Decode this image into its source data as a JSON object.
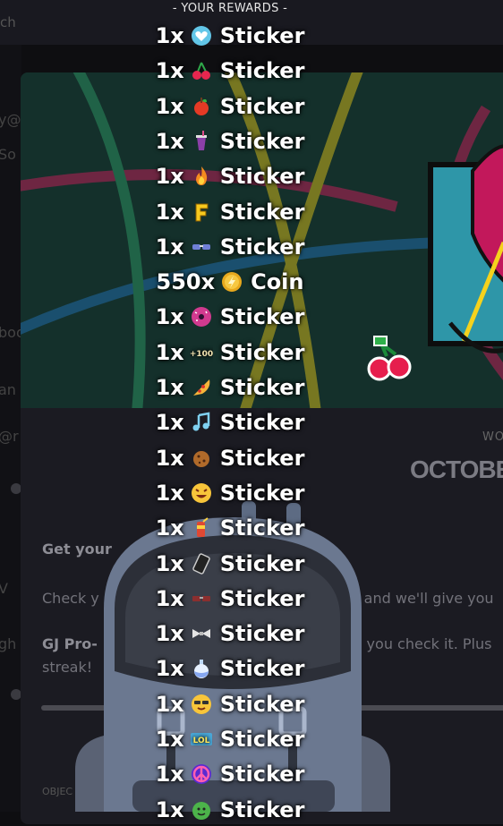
{
  "background": {
    "search_fragment": "ch",
    "sidebar_fragments": [
      "y@",
      "So",
      "boo",
      "an",
      "@r",
      "V",
      "gh"
    ],
    "date_small": "WO",
    "date_big": "OCTOBER",
    "quest_title": "Get your",
    "quest_desc_left": "Check y",
    "quest_desc_right": "r and we'll give you",
    "quest_line2_left": "GJ Pro-",
    "quest_line2_right": "y you check it. Plus",
    "quest_line3": "streak!",
    "objective_label": "OBJEC"
  },
  "rewards": {
    "header": "- YOUR REWARDS -",
    "items": [
      {
        "qty": "1x",
        "name": "Sticker",
        "icon": "heart-hands-sticker-icon"
      },
      {
        "qty": "1x",
        "name": "Sticker",
        "icon": "cherries-sticker-icon"
      },
      {
        "qty": "1x",
        "name": "Sticker",
        "icon": "apple-sticker-icon"
      },
      {
        "qty": "1x",
        "name": "Sticker",
        "icon": "soda-cup-sticker-icon"
      },
      {
        "qty": "1x",
        "name": "Sticker",
        "icon": "fire-sticker-icon"
      },
      {
        "qty": "1x",
        "name": "Sticker",
        "icon": "letter-f-sticker-icon"
      },
      {
        "qty": "1x",
        "name": "Sticker",
        "icon": "sunglasses-sticker-icon"
      },
      {
        "qty": "550x",
        "name": "Coin",
        "icon": "coin-icon"
      },
      {
        "qty": "1x",
        "name": "Sticker",
        "icon": "donut-sticker-icon"
      },
      {
        "qty": "1x",
        "name": "Sticker",
        "icon": "plus-100-sticker-icon"
      },
      {
        "qty": "1x",
        "name": "Sticker",
        "icon": "pizza-sticker-icon"
      },
      {
        "qty": "1x",
        "name": "Sticker",
        "icon": "music-note-sticker-icon"
      },
      {
        "qty": "1x",
        "name": "Sticker",
        "icon": "cookie-sticker-icon"
      },
      {
        "qty": "1x",
        "name": "Sticker",
        "icon": "laughing-face-sticker-icon"
      },
      {
        "qty": "1x",
        "name": "Sticker",
        "icon": "drink-can-sticker-icon"
      },
      {
        "qty": "1x",
        "name": "Sticker",
        "icon": "phone-sticker-icon"
      },
      {
        "qty": "1x",
        "name": "Sticker",
        "icon": "shades-sticker-icon"
      },
      {
        "qty": "1x",
        "name": "Sticker",
        "icon": "bow-tie-sticker-icon"
      },
      {
        "qty": "1x",
        "name": "Sticker",
        "icon": "potion-sticker-icon"
      },
      {
        "qty": "1x",
        "name": "Sticker",
        "icon": "cool-face-sticker-icon"
      },
      {
        "qty": "1x",
        "name": "Sticker",
        "icon": "lol-sticker-icon"
      },
      {
        "qty": "1x",
        "name": "Sticker",
        "icon": "peace-sign-sticker-icon"
      },
      {
        "qty": "1x",
        "name": "Sticker",
        "icon": "green-face-sticker-icon"
      }
    ]
  },
  "colors": {
    "background": "#0e0e11",
    "card": "#1b1b22",
    "banner": "#15322c",
    "mascot": "#6b7890",
    "reward_text": "#ffffff"
  }
}
